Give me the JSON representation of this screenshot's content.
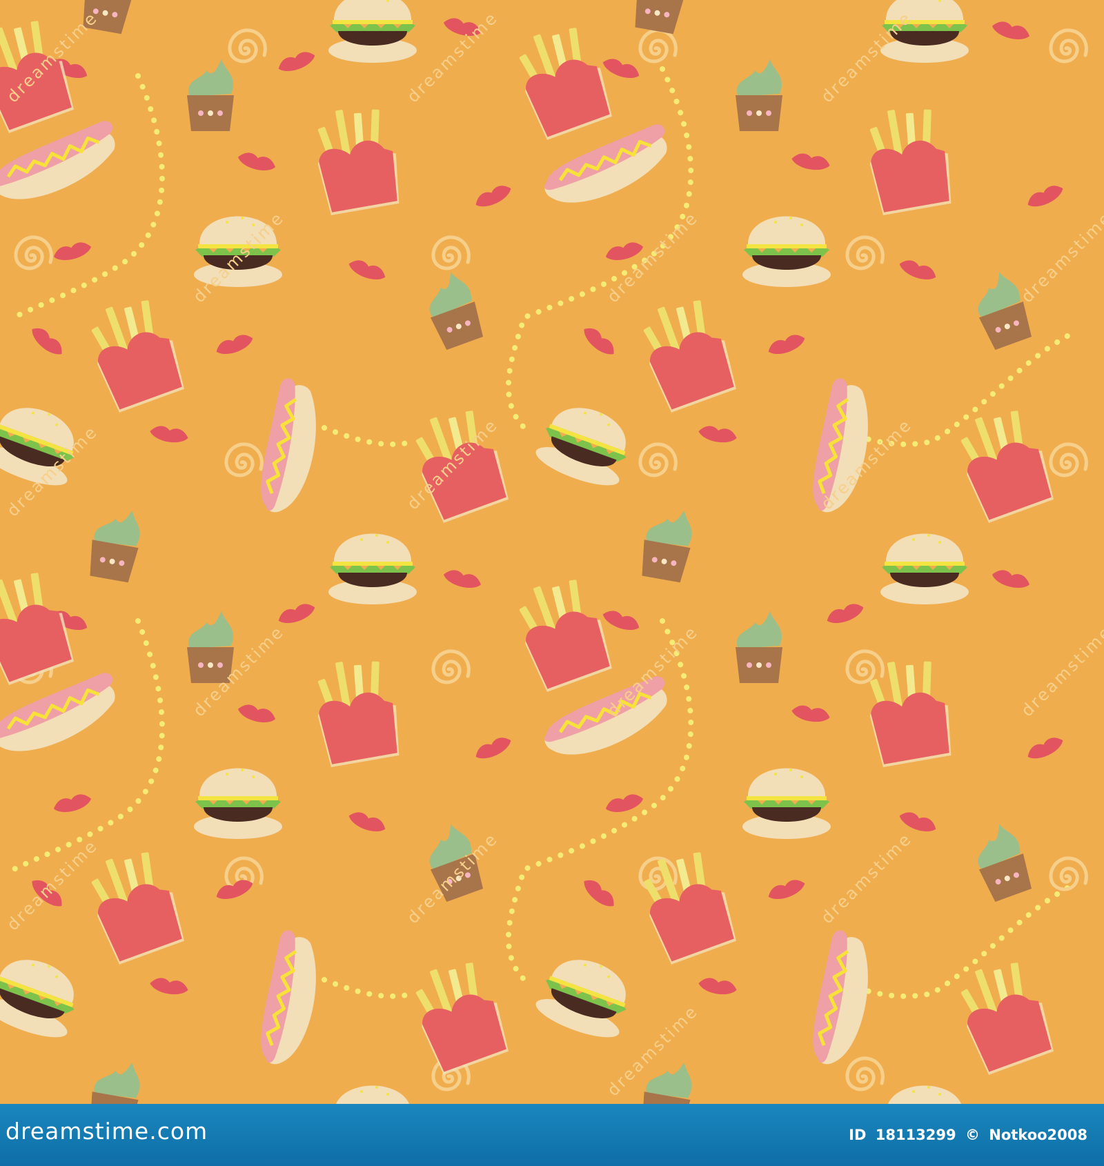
{
  "pattern": {
    "background_color": "#f0ad4e",
    "motifs": [
      "burger",
      "french-fries",
      "hot-dog",
      "cupcake",
      "lips",
      "dotted-path"
    ],
    "colors": {
      "bun": "#f2dfb7",
      "patty": "#4a2b22",
      "lettuce": "#7cc24b",
      "cheese": "#f4e442",
      "fries_box": "#e65f61",
      "fries": "#eede6c",
      "sausage": "#ef9fa6",
      "mustard": "#f6e239",
      "cupcake_liner": "#a8744a",
      "frosting": "#9bbf8a",
      "lips": "#e2545f",
      "dots": "#f4ec74",
      "watermark": "#f6cf8b"
    }
  },
  "watermark": {
    "text": "dreamstime",
    "icon": "spiral-logo-icon"
  },
  "footer": {
    "bar_color": "#1281ba",
    "site": "dreamstime.com",
    "id_label": "ID",
    "id_number": "18113299",
    "copyright": "©",
    "author": "Notkoo2008"
  }
}
